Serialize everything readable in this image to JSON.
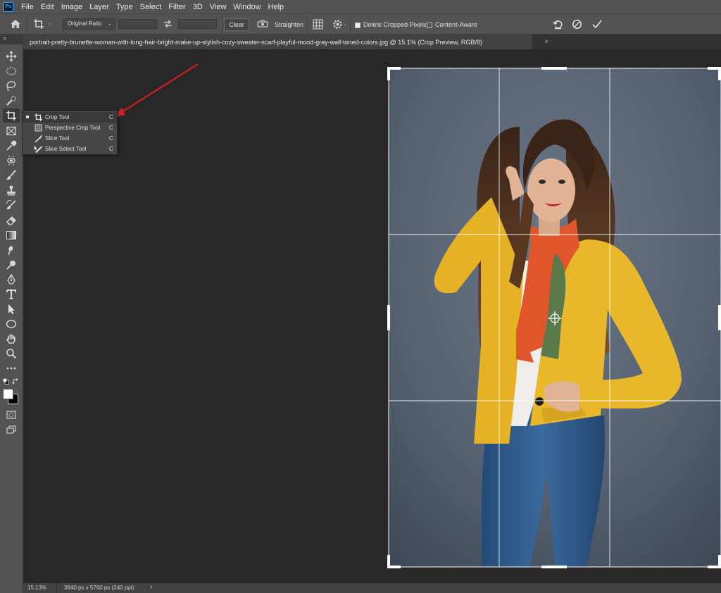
{
  "menubar": {
    "logo": "Ps",
    "items": [
      "File",
      "Edit",
      "Image",
      "Layer",
      "Type",
      "Select",
      "Filter",
      "3D",
      "View",
      "Window",
      "Help"
    ]
  },
  "options": {
    "ratio_label": "Original Ratio",
    "clear_label": "Clear",
    "straighten_label": "Straighten",
    "delete_cropped_label": "Delete Cropped Pixels",
    "delete_cropped_checked": true,
    "content_aware_label": "Content-Aware",
    "content_aware_checked": false
  },
  "document": {
    "tab_title": "portrait-pretty-brunette-woman-with-long-hair-bright-make-up-stylish-cozy-sweater-scarf-playful-mood-gray-wall-toned-colors.jpg @ 15.1% (Crop Preview, RGB/8)",
    "close": "×"
  },
  "toolbar": {
    "collapse": "»"
  },
  "flyout": {
    "items": [
      {
        "label": "Crop Tool",
        "key": "C",
        "active": true
      },
      {
        "label": "Perspective Crop Tool",
        "key": "C",
        "active": false
      },
      {
        "label": "Slice Tool",
        "key": "C",
        "active": false
      },
      {
        "label": "Slice Select Tool",
        "key": "C",
        "active": false
      }
    ]
  },
  "status": {
    "zoom": "15.13%",
    "doc_info": "3840 px x 5760 px (240 ppi)",
    "arrow": "›"
  },
  "colors": {
    "annotation_arrow": "#d41f1f",
    "backdrop": "#5c6878",
    "sweater": "#e8b82a",
    "jeans": "#2f5a8c"
  }
}
